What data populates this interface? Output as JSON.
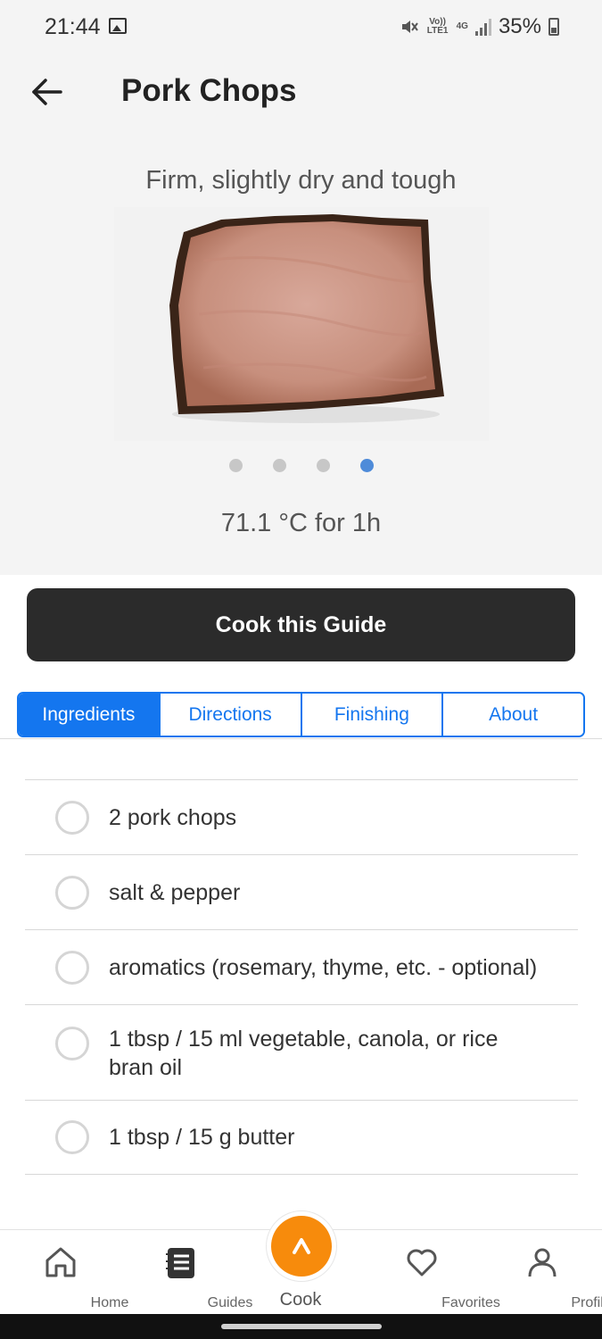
{
  "status_bar": {
    "time": "21:44",
    "volte_label": "Vo)) LTE1",
    "network_label": "4G",
    "battery_percent": "35%",
    "icons": [
      "gallery-icon",
      "mute-icon",
      "signal-icon",
      "battery-icon"
    ]
  },
  "header": {
    "back_icon": "arrow-left-icon",
    "title": "Pork Chops"
  },
  "hero": {
    "caption": "Firm, slightly dry and tough",
    "image_subject": "pork-chop-image",
    "carousel": {
      "total": 4,
      "active_index": 3
    },
    "temperature": "71.1 °C for 1h"
  },
  "actions": {
    "cook_guide_label": "Cook this Guide"
  },
  "tabs": [
    {
      "label": "Ingredients",
      "active": true
    },
    {
      "label": "Directions",
      "active": false
    },
    {
      "label": "Finishing",
      "active": false
    },
    {
      "label": "About",
      "active": false
    }
  ],
  "ingredients": [
    {
      "text": "2 pork chops"
    },
    {
      "text": "salt & pepper"
    },
    {
      "text": "aromatics (rosemary, thyme, etc. - optional)"
    },
    {
      "text": "1 tbsp / 15 ml vegetable, canola, or rice bran oil"
    },
    {
      "text": "1 tbsp / 15 g butter"
    }
  ],
  "bottom_nav": {
    "home_label": "Home",
    "guides_label": "Guides",
    "cook_label": "Cook",
    "favorites_label": "Favorites",
    "profile_label": "Profile"
  },
  "colors": {
    "accent_blue": "#1476ef",
    "dot_active": "#4e8bd9",
    "cook_orange": "#f78b0c",
    "dark_button": "#2b2b2b"
  }
}
